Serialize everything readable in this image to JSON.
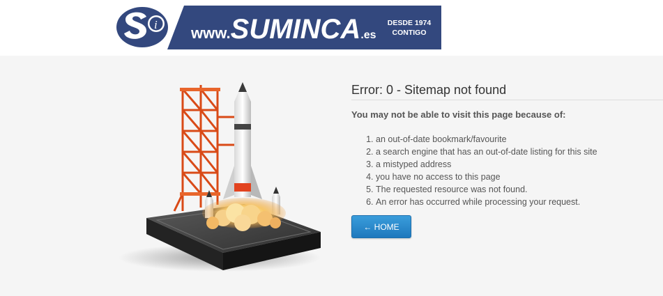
{
  "header": {
    "logo": {
      "prefix": "www.",
      "brand": "SUMINCA",
      "suffix": ".es",
      "tagline_line1": "DESDE 1974",
      "tagline_line2": "CONTIGO",
      "badge_letters": "Si",
      "colors": {
        "navy": "#33487e",
        "white": "#ffffff"
      }
    }
  },
  "main": {
    "title": "Error: 0 - Sitemap not found",
    "intro": "You may not be able to visit this page because of:",
    "reasons": [
      "an out-of-date bookmark/favourite",
      "a search engine that has an out-of-date listing for this site",
      "a mistyped address",
      "you have no access to this page",
      "The requested resource was not found.",
      "An error has occurred while processing your request."
    ],
    "home_button": {
      "label": "← HOME",
      "color": "#2b8bd0"
    }
  },
  "illustration": {
    "icon": "rocket-launch-pad-icon"
  }
}
